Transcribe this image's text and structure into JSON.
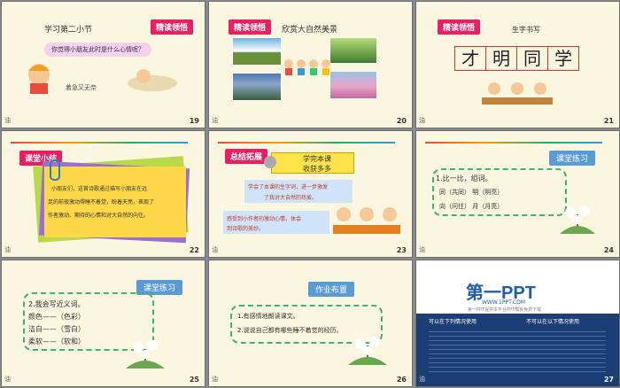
{
  "slides": [
    {
      "num": "19",
      "heading": "学习第二小节",
      "badge": "精读领悟",
      "question": "你觉得小朋友此时是什么心情呢？",
      "answer": "着急又无奈",
      "foot": "油"
    },
    {
      "num": "20",
      "badge": "精读领悟",
      "heading": "欣赏大自然美景",
      "foot": "油"
    },
    {
      "num": "21",
      "badge": "精读领悟",
      "heading": "生字书写",
      "chars": [
        "才",
        "明",
        "同",
        "学"
      ],
      "foot": "油"
    },
    {
      "num": "22",
      "badge": "课堂小结",
      "body": [
        "小朋友们，这首诗歌通过描写小朋友在远",
        "足的前夜激动得睡不着觉，盼着天亮，表现了",
        "作者激动、期待的心情和对大自然的向往。"
      ],
      "foot": "油"
    },
    {
      "num": "23",
      "badge": "总结拓展",
      "box": [
        "学完本课",
        "收获多多"
      ],
      "line1": [
        "学会了本课的生字词，进一步激发",
        "了我对大自然的热爱。"
      ],
      "line2": [
        "感受到小作者的激动心情，体会",
        "到诗歌的美妙。"
      ],
      "foot": "油"
    },
    {
      "num": "24",
      "badge": "课堂练习",
      "title": "1.比一比，组词。",
      "rows": [
        "同（共同）  明（明亮）",
        "向（问往）  月（月亮）"
      ],
      "foot": "油"
    },
    {
      "num": "25",
      "badge": "课堂练习",
      "title": "2.我会写近义词。",
      "rows": [
        "颜色——（色彩）",
        "洁白——（雪白）",
        "柔软——（软和）"
      ],
      "foot": "油"
    },
    {
      "num": "26",
      "badge": "作业布置",
      "rows": [
        "1.有感情地朗读课文。",
        "2.说说自己都有哪些睡不着觉的经历。"
      ],
      "foot": "油"
    },
    {
      "num": "27",
      "logo": "第一PPT",
      "url": "WWW.1PPT.COM",
      "url2": "第一PPT提供本平台PPT模板免费下载",
      "col1": "可以在下列情况使用",
      "col2": "不可以在以下情况使用",
      "foot": "油"
    }
  ]
}
